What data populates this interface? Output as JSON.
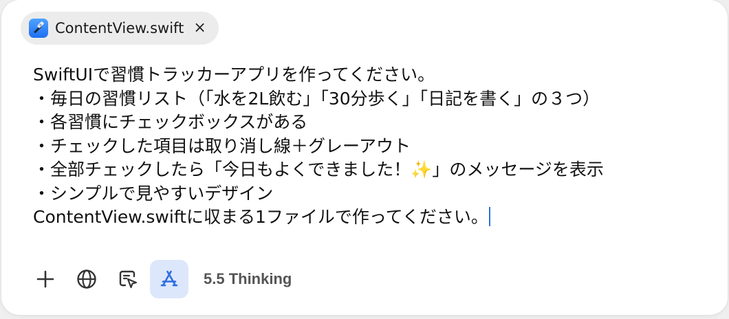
{
  "attachment": {
    "file_name": "ContentView.swift",
    "close_label": "×",
    "icon": "xcode-hammer-icon"
  },
  "prompt": {
    "lines": [
      "SwiftUIで習慣トラッカーアプリを作ってください。",
      "・毎日の習慣リスト（「水を2L飲む」「30分歩く」「日記を書く」の３つ）",
      "・各習慣にチェックボックスがある",
      "・チェックした項目は取り消し線＋グレーアウト",
      "・全部チェックしたら「今日もよくできました！✨」のメッセージを表示",
      "・シンプルで見やすいデザイン",
      "ContentView.swiftに収まる1ファイルで作ってください。"
    ]
  },
  "toolbar": {
    "buttons": [
      {
        "icon": "plus-icon"
      },
      {
        "icon": "globe-icon"
      },
      {
        "icon": "select-cursor-icon"
      },
      {
        "icon": "app-store-icon",
        "active": true
      }
    ],
    "model_label": "5.5 Thinking"
  },
  "colors": {
    "accent": "#2f6fe0",
    "active_bg": "#dde7fb",
    "chip_bg": "#ececec"
  }
}
